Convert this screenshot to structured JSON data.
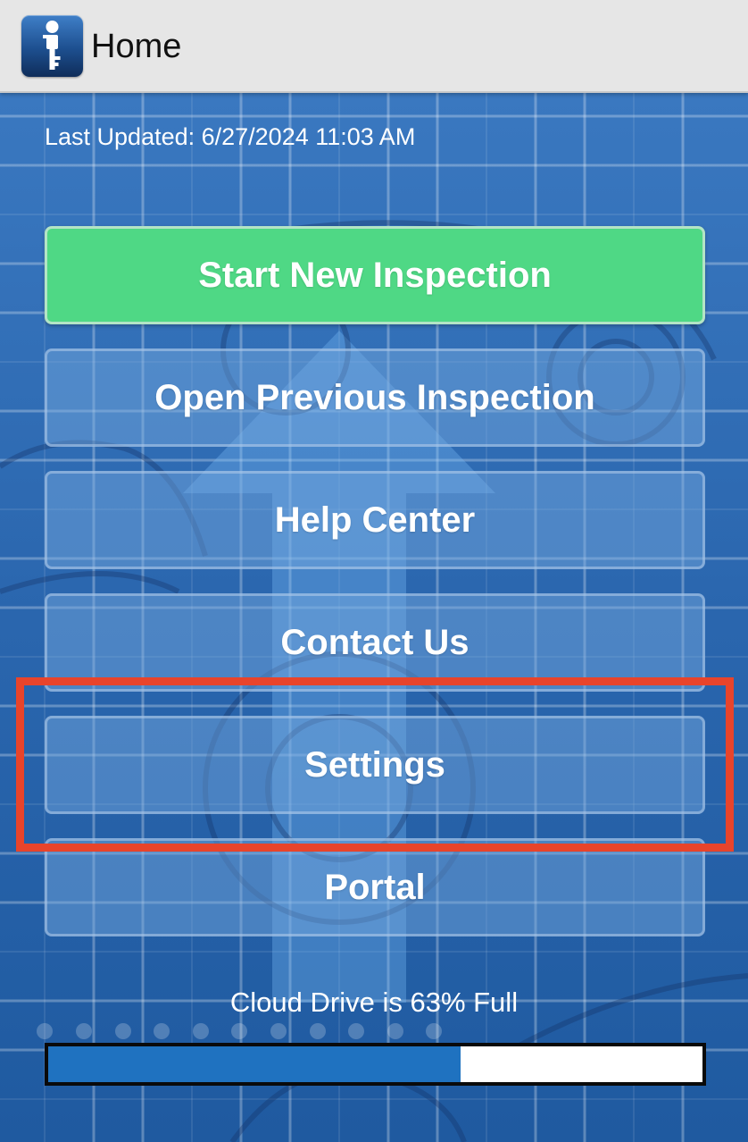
{
  "app_bar": {
    "title": "Home",
    "icon": "key-info-app-icon"
  },
  "status": {
    "last_updated": "Last Updated: 6/27/2024 11:03 AM"
  },
  "menu": {
    "items": [
      {
        "label": "Start New Inspection",
        "color": "#4fd885"
      },
      {
        "label": "Open Previous Inspection"
      },
      {
        "label": "Help Center"
      },
      {
        "label": "Contact Us"
      },
      {
        "label": "Settings",
        "highlighted": true
      },
      {
        "label": "Portal"
      }
    ]
  },
  "storage": {
    "label": "Cloud Drive is 63% Full",
    "fill_fraction": 0.63,
    "fill_color": "#1f72c0"
  },
  "colors": {
    "highlight": "#e8442b",
    "background": "#2a6ab4"
  }
}
